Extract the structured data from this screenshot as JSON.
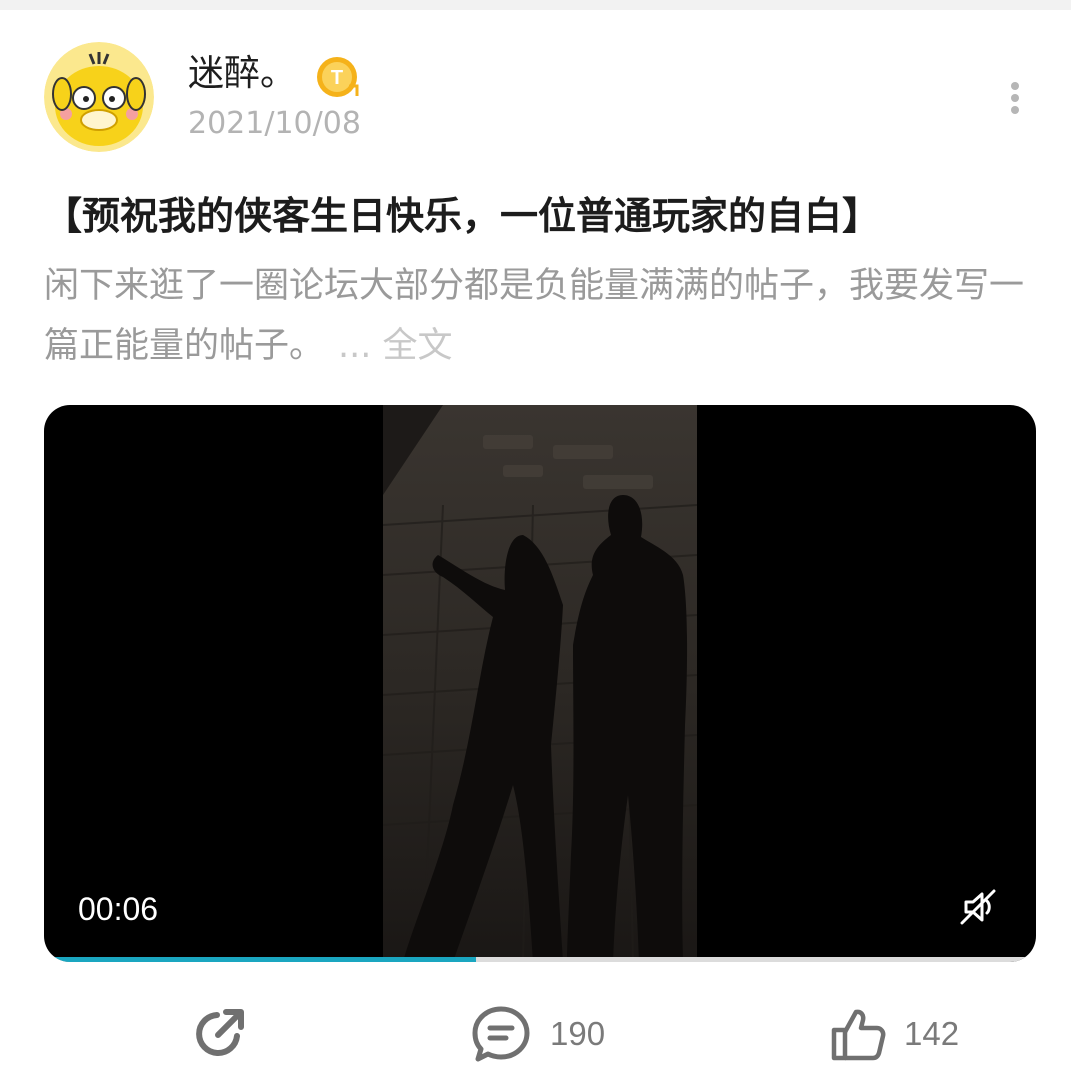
{
  "post": {
    "author_name": "迷醉。",
    "badge_letter": "T",
    "date": "2021/10/08",
    "title": "【预祝我的侠客生日快乐，一位普通玩家的自白】",
    "body": "闲下来逛了一圈论坛大部分都是负能量满满的帖子，我要发写一篇正能量的帖子。",
    "read_more": "... 全文"
  },
  "video": {
    "current_time": "00:06",
    "progress": 0.435
  },
  "actions": {
    "share_icon": "share-icon",
    "comment_icon": "comment-icon",
    "comment_count": "190",
    "like_icon": "thumbs-up-icon",
    "like_count": "142"
  },
  "colors": {
    "progress": "#1aa6c0",
    "badge": "#f5b21a",
    "muted_text": "#9a9a9a"
  }
}
